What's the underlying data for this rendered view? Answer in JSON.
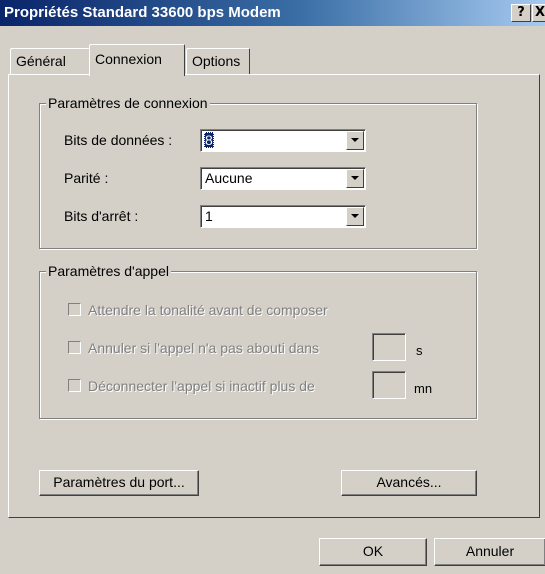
{
  "window": {
    "title": "Propriétés Standard 33600 bps Modem",
    "help_glyph": "?",
    "close_glyph": "X"
  },
  "tabs": [
    {
      "label": "Général",
      "active": false
    },
    {
      "label": "Connexion",
      "active": true
    },
    {
      "label": "Options",
      "active": false
    }
  ],
  "connection_group": {
    "title": "Paramètres de connexion",
    "fields": [
      {
        "label": "Bits de données :",
        "value": "8"
      },
      {
        "label": "Parité :",
        "value": "Aucune"
      },
      {
        "label": "Bits d'arrêt :",
        "value": "1"
      }
    ]
  },
  "call_group": {
    "title": "Paramètres d'appel",
    "options": [
      {
        "label": "Attendre la tonalité avant de composer",
        "checked": false,
        "enabled": false
      },
      {
        "label": "Annuler si l'appel n'a pas abouti dans",
        "checked": false,
        "enabled": false,
        "unit": "s"
      },
      {
        "label": "Déconnecter l'appel si inactif plus de",
        "checked": false,
        "enabled": false,
        "unit": "mn"
      }
    ]
  },
  "buttons": {
    "port_settings": "Paramètres du port...",
    "advanced": "Avancés...",
    "ok": "OK",
    "cancel": "Annuler"
  },
  "colors": {
    "face": "#d4d0c8",
    "title_start": "#0a246a",
    "title_end": "#a6caf0",
    "disabled_text": "#808080"
  }
}
